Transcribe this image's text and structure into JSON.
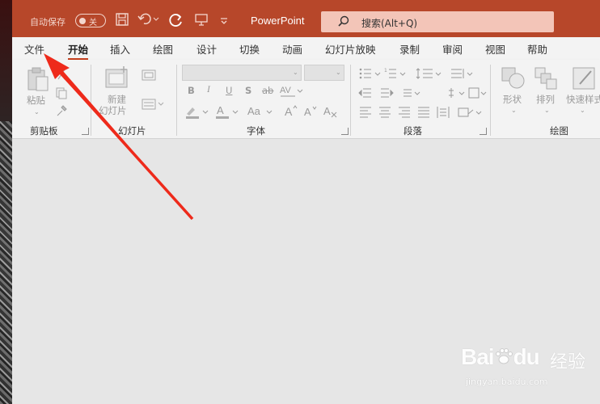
{
  "title_bar": {
    "autosave_label": "自动保存",
    "autosave_state": "关",
    "app_title": "PowerPoint",
    "search_placeholder": "搜索(Alt+Q)",
    "accent_color": "#b7472a"
  },
  "tabs": [
    {
      "label": "文件",
      "active": false
    },
    {
      "label": "开始",
      "active": true
    },
    {
      "label": "插入",
      "active": false
    },
    {
      "label": "绘图",
      "active": false
    },
    {
      "label": "设计",
      "active": false
    },
    {
      "label": "切换",
      "active": false
    },
    {
      "label": "动画",
      "active": false
    },
    {
      "label": "幻灯片放映",
      "active": false
    },
    {
      "label": "录制",
      "active": false
    },
    {
      "label": "审阅",
      "active": false
    },
    {
      "label": "视图",
      "active": false
    },
    {
      "label": "帮助",
      "active": false
    }
  ],
  "ribbon": {
    "clipboard": {
      "group_label": "剪贴板",
      "paste_label": "粘贴"
    },
    "slides": {
      "group_label": "幻灯片",
      "new_slide_line1": "新建",
      "new_slide_line2": "幻灯片"
    },
    "font": {
      "group_label": "字体",
      "bold": "B",
      "italic": "I",
      "underline": "U",
      "strike": "S",
      "shadow": "ab"
    },
    "paragraph": {
      "group_label": "段落"
    },
    "drawing": {
      "group_label": "绘图",
      "shapes_label": "形状",
      "arrange_label": "排列",
      "quick_styles_label": "快速样式"
    }
  },
  "watermark": {
    "brand": "Bai",
    "brand_suffix": "du",
    "jingyan": "经验",
    "url": "jingyan.baidu.com"
  }
}
